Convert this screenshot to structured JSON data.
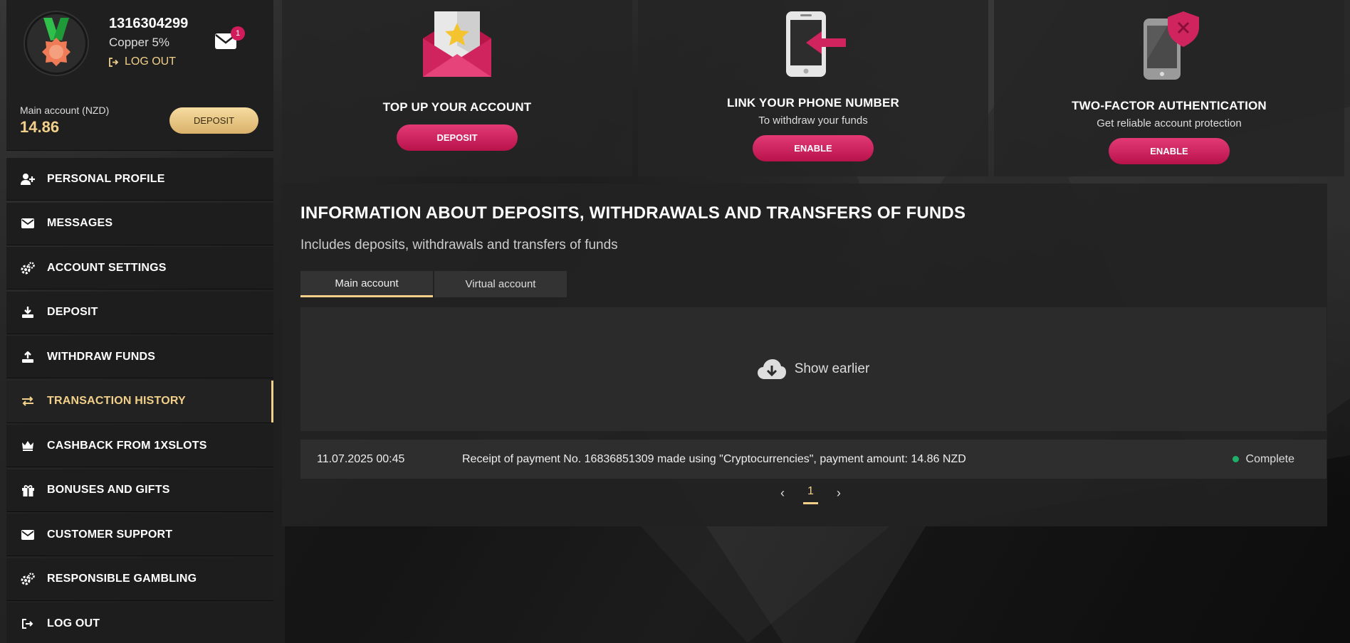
{
  "profile": {
    "user_id": "1316304299",
    "rank": "Copper 5%",
    "logout_label": "LOG OUT",
    "unread_messages": "1",
    "account_label": "Main account (NZD)",
    "balance": "14.86",
    "deposit_label": "DEPOSIT"
  },
  "menu": {
    "items": [
      {
        "label": "PERSONAL PROFILE",
        "icon": "user-plus-icon"
      },
      {
        "label": "MESSAGES",
        "icon": "envelope-icon"
      },
      {
        "label": "ACCOUNT SETTINGS",
        "icon": "gears-icon"
      },
      {
        "label": "DEPOSIT",
        "icon": "download-icon"
      },
      {
        "label": "WITHDRAW FUNDS",
        "icon": "upload-icon"
      },
      {
        "label": "TRANSACTION HISTORY",
        "icon": "exchange-icon",
        "active": true
      },
      {
        "label": "CASHBACK FROM 1XSLOTS",
        "icon": "crown-icon"
      },
      {
        "label": "BONUSES AND GIFTS",
        "icon": "gift-icon"
      },
      {
        "label": "CUSTOMER SUPPORT",
        "icon": "envelope-icon"
      },
      {
        "label": "RESPONSIBLE GAMBLING",
        "icon": "gears-icon"
      },
      {
        "label": "LOG OUT",
        "icon": "logout-icon"
      }
    ]
  },
  "cards": {
    "topup": {
      "title": "TOP UP YOUR ACCOUNT",
      "button": "DEPOSIT"
    },
    "phone": {
      "title": "LINK YOUR PHONE NUMBER",
      "subtitle": "To withdraw your funds",
      "button": "ENABLE"
    },
    "twofa": {
      "title": "TWO-FACTOR AUTHENTICATION",
      "subtitle": "Get reliable account protection",
      "button": "ENABLE"
    }
  },
  "history": {
    "title": "INFORMATION ABOUT DEPOSITS, WITHDRAWALS AND TRANSFERS OF FUNDS",
    "subtitle": "Includes deposits, withdrawals and transfers of funds",
    "tabs": [
      {
        "label": "Main account",
        "active": true
      },
      {
        "label": "Virtual account",
        "active": false
      }
    ],
    "show_earlier": "Show earlier",
    "transactions": [
      {
        "date": "11.07.2025 00:45",
        "description": "Receipt of payment No. 16836851309 made using \"Cryptocurrencies\", payment amount: 14.86 NZD",
        "status": "Complete"
      }
    ],
    "pagination": {
      "current": "1"
    }
  },
  "colors": {
    "accent_gold": "#f2d08a",
    "accent_pink": "#d11c5b",
    "status_complete": "#1fb06a"
  }
}
